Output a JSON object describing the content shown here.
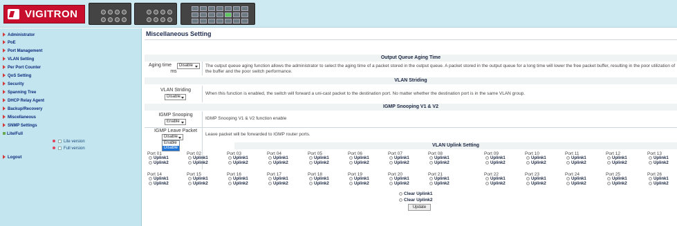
{
  "logo": {
    "text": "VIGITRON",
    "accent": "#c8102e"
  },
  "sidebar": {
    "items": [
      {
        "label": "Administrator"
      },
      {
        "label": "PoE"
      },
      {
        "label": "Port Management"
      },
      {
        "label": "VLAN Setting"
      },
      {
        "label": "Per Port Counter"
      },
      {
        "label": "QoS Setting"
      },
      {
        "label": "Security"
      },
      {
        "label": "Spanning Tree"
      },
      {
        "label": "DHCP Relay Agent"
      },
      {
        "label": "Backup/Recovery"
      },
      {
        "label": "Miscellaneous"
      },
      {
        "label": "SNMP Settings"
      },
      {
        "label": "Lite/Full"
      }
    ],
    "versions": {
      "lite": "Lite version",
      "full": "Full version"
    },
    "logout": "Logout"
  },
  "main": {
    "title": "Miscellaneous Setting",
    "aging": {
      "section": "Output Queue Aging Time",
      "label_1": "Aging time",
      "label_2": "ms",
      "value": "Disable",
      "desc": "The output queue aging function allows the administrator to select the aging time of a packet stored in the output queue. A packet stored in the output queue for a long time will lower the free packet buffer, resulting in the poor utilization of the buffer and the poor switch performance."
    },
    "vlan_striding": {
      "section": "VLAN Striding",
      "label": "VLAN Striding",
      "value": "Disable",
      "desc": "When this function is enabled, the switch will forward a uni-cast packet to the destination port. No matter whether the destination port is in the same VLAN group."
    },
    "igmp": {
      "section": "IGMP Snooping V1 & V2",
      "snoop_label": "IGMP Snooping",
      "snoop_value": "Enable",
      "snoop_desc": "IGMP Snooping V1 & V2 function enable",
      "leave_label": "IGMP Leave Packet",
      "leave_value": "Disable",
      "leave_options": [
        "Enable",
        "Disable"
      ],
      "leave_desc": "Leave packet will be forwarded to IGMP router ports."
    },
    "uplink": {
      "section": "VLAN Uplink Setting",
      "uplink1": "Uplink1",
      "uplink2": "Uplink2",
      "ports_row1": [
        "Port 01",
        "Port 02",
        "Port 03",
        "Port 04",
        "Port 05",
        "Port 06",
        "Port 07",
        "Port 08",
        "Port 09",
        "Port 10",
        "Port 11",
        "Port 12",
        "Port 13"
      ],
      "ports_row2": [
        "Port 14",
        "Port 15",
        "Port 16",
        "Port 17",
        "Port 18",
        "Port 19",
        "Port 20",
        "Port 21",
        "Port 22",
        "Port 23",
        "Port 24",
        "Port 25",
        "Port 26"
      ],
      "clear1": "Clear Uplink1",
      "clear2": "Clear Uplink2",
      "update": "Update"
    }
  }
}
